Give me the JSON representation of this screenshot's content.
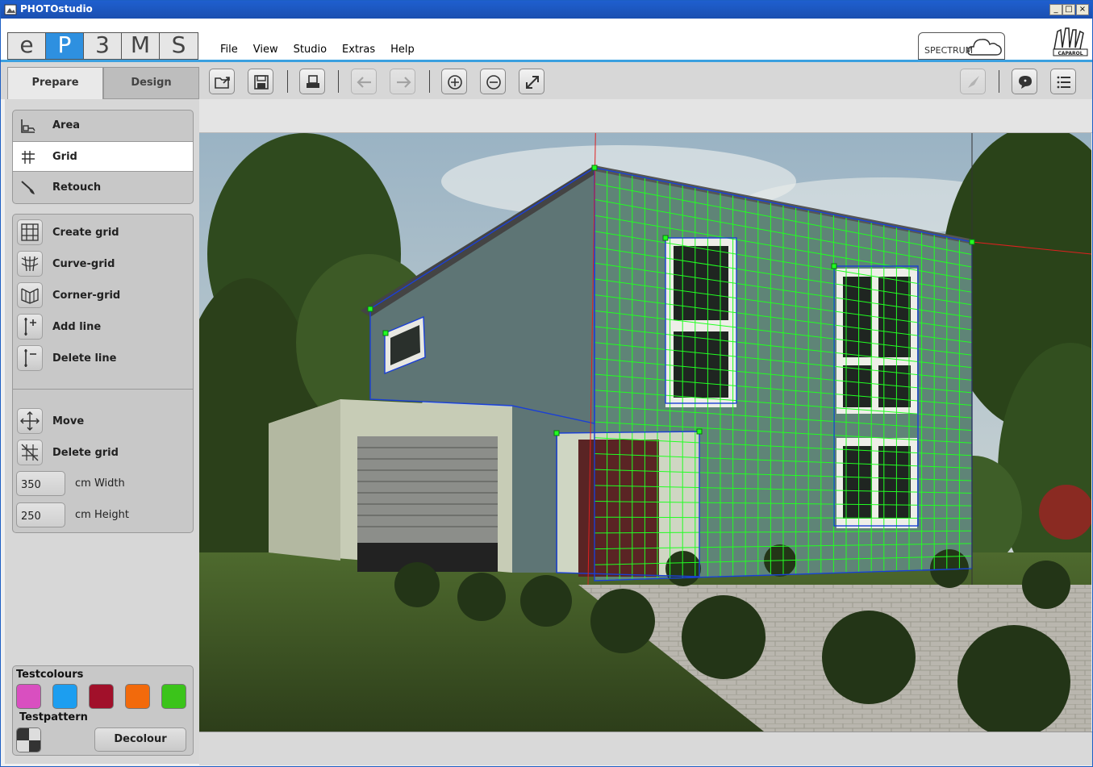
{
  "window": {
    "title": "PHOTOstudio",
    "controls": [
      "_",
      "□",
      "×"
    ]
  },
  "brand_tabs": [
    {
      "label": "e",
      "active": false
    },
    {
      "label": "P",
      "active": true
    },
    {
      "label": "3",
      "active": false
    },
    {
      "label": "M",
      "active": false
    },
    {
      "label": "S",
      "active": false
    }
  ],
  "menu": [
    "File",
    "View",
    "Studio",
    "Extras",
    "Help"
  ],
  "spectrum_label": "SPECTRUM",
  "caparol_label": "CAPAROL",
  "panel_tabs": {
    "prepare": "Prepare",
    "design": "Design"
  },
  "modes": [
    {
      "label": "Area",
      "icon": "area-icon",
      "selected": false
    },
    {
      "label": "Grid",
      "icon": "grid-icon",
      "selected": true
    },
    {
      "label": "Retouch",
      "icon": "brush-icon",
      "selected": false
    }
  ],
  "grid_tools": [
    {
      "label": "Create grid",
      "icon": "create-grid-icon"
    },
    {
      "label": "Curve-grid",
      "icon": "curve-grid-icon"
    },
    {
      "label": "Corner-grid",
      "icon": "corner-grid-icon"
    },
    {
      "label": "Add line",
      "icon": "add-line-icon"
    },
    {
      "label": "Delete line",
      "icon": "delete-line-icon"
    }
  ],
  "edit_tools": [
    {
      "label": "Move",
      "icon": "move-icon"
    },
    {
      "label": "Delete grid",
      "icon": "delete-grid-icon"
    }
  ],
  "dimensions": {
    "width_value": "350",
    "width_label": "cm Width",
    "height_value": "250",
    "height_label": "cm Height"
  },
  "testcolours": {
    "title": "Testcolours",
    "colors": [
      "#d94fc0",
      "#1c9ef0",
      "#a1102a",
      "#f26a0c",
      "#3bc41a"
    ],
    "pattern_title": "Testpattern",
    "decolour_label": "Decolour"
  },
  "toolbar": {
    "buttons": [
      {
        "name": "open-button",
        "icon": "open-folder-icon",
        "enabled": true
      },
      {
        "name": "save-button",
        "icon": "save-icon",
        "enabled": true
      },
      {
        "name": "print-button",
        "icon": "print-icon",
        "enabled": true
      },
      {
        "name": "undo-button",
        "icon": "arrow-left-icon",
        "enabled": false
      },
      {
        "name": "redo-button",
        "icon": "arrow-right-icon",
        "enabled": false
      },
      {
        "name": "zoom-in-button",
        "icon": "zoom-in-icon",
        "enabled": true
      },
      {
        "name": "zoom-out-button",
        "icon": "zoom-out-icon",
        "enabled": true
      },
      {
        "name": "fit-button",
        "icon": "expand-icon",
        "enabled": true
      },
      {
        "name": "share-button",
        "icon": "rocket-icon",
        "enabled": false
      },
      {
        "name": "chat-button",
        "icon": "chat-icon",
        "enabled": true
      },
      {
        "name": "list-button",
        "icon": "list-icon",
        "enabled": true
      }
    ]
  },
  "colors": {
    "accent": "#2e90e0",
    "grid": "#22ff22",
    "grid_outline": "#1a3fd6",
    "guide": "#e02020"
  }
}
